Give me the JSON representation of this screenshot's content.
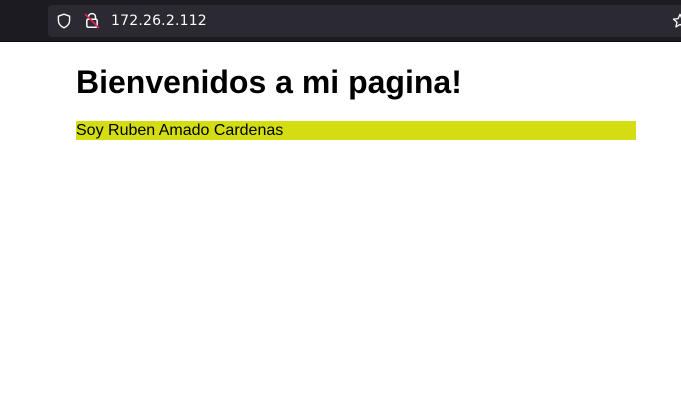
{
  "browser": {
    "url": "172.26.2.112",
    "icons": {
      "tracking_protection": "shield-icon",
      "connection": "lock-insecure-icon",
      "bookmark": "star-icon"
    },
    "colors": {
      "toolbar_bg": "#1c1b22",
      "urlbar_bg": "#2b2a33",
      "url_text": "#fbfbfe",
      "insecure_slash": "#e22850"
    }
  },
  "page": {
    "title": "Bienvenidos a mi pagina!",
    "intro": "Soy Ruben Amado Cardenas",
    "colors": {
      "background": "#ffffff",
      "highlight": "#d3dd12"
    }
  }
}
